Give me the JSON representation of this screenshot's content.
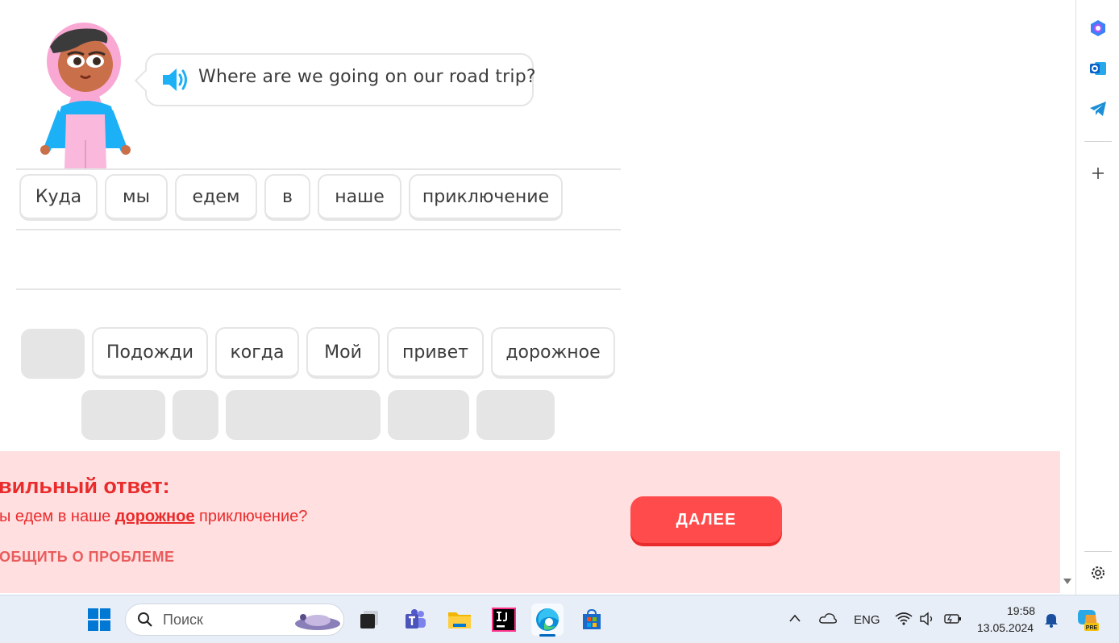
{
  "prompt": {
    "sentence": "Where are we going on our road trip?"
  },
  "answer_tiles": [
    "Куда",
    "мы",
    "едем",
    "в",
    "наше",
    "приключение"
  ],
  "bank_tiles": [
    "Подожди",
    "когда",
    "Мой",
    "привет",
    "дорожное"
  ],
  "feedback": {
    "title": "вильный ответ:",
    "answer_before": "ы едем в наше ",
    "answer_highlight": "дорожное",
    "answer_after": " приключение?",
    "report": "ОБЩИТЬ О ПРОБЛЕМЕ",
    "next_button": "ДАЛЕЕ",
    "colors": {
      "background": "#ffdfe0",
      "accent": "#ea2b2b",
      "button": "#ff4b4b"
    }
  },
  "taskbar": {
    "search_placeholder": "Поиск",
    "apps": [
      "start-icon",
      "task-view-icon",
      "teams-icon",
      "file-explorer-icon",
      "intellij-icon",
      "edge-icon",
      "store-icon"
    ],
    "language": "ENG",
    "time": "19:58",
    "date": "13.05.2024"
  },
  "sidebar": {
    "icons": [
      "copilot-icon",
      "outlook-icon",
      "telegram-icon",
      "add-icon",
      "settings-icon"
    ]
  }
}
